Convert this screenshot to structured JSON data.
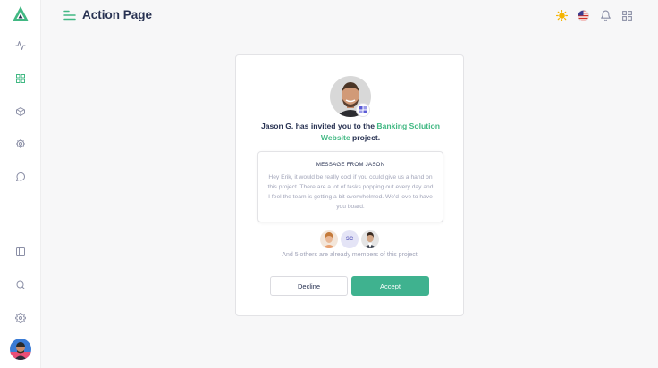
{
  "colors": {
    "brand": "#41b883",
    "accept": "#3fb28f",
    "title": "#283252",
    "muted": "#a2a5b9"
  },
  "header": {
    "title": "Action Page",
    "icons": [
      "sun-icon",
      "us-flag-icon",
      "bell-icon",
      "apps-grid-icon"
    ]
  },
  "sidebar": {
    "top_icons": [
      "activity-icon",
      "grid-icon",
      "box-icon",
      "settings-cog-icon",
      "chat-icon"
    ],
    "bottom_icons": [
      "layout-panel-icon",
      "search-icon",
      "settings-icon"
    ]
  },
  "invite": {
    "inviter": "Jason G.",
    "text_before": "Jason G. has invited you to the ",
    "project": "Banking Solution Website",
    "text_after": " project."
  },
  "message": {
    "label": "MESSAGE FROM JASON",
    "body": "Hey Erik, it would be really cool if you could give us a hand on this project. There are a lot of tasks popping out every day and I feel the team is getting a bit overwhelmed. We'd love to have you board."
  },
  "members": {
    "initials": "SC",
    "note": "And 5 others are already members of this project"
  },
  "actions": {
    "decline": "Decline",
    "accept": "Accept"
  }
}
